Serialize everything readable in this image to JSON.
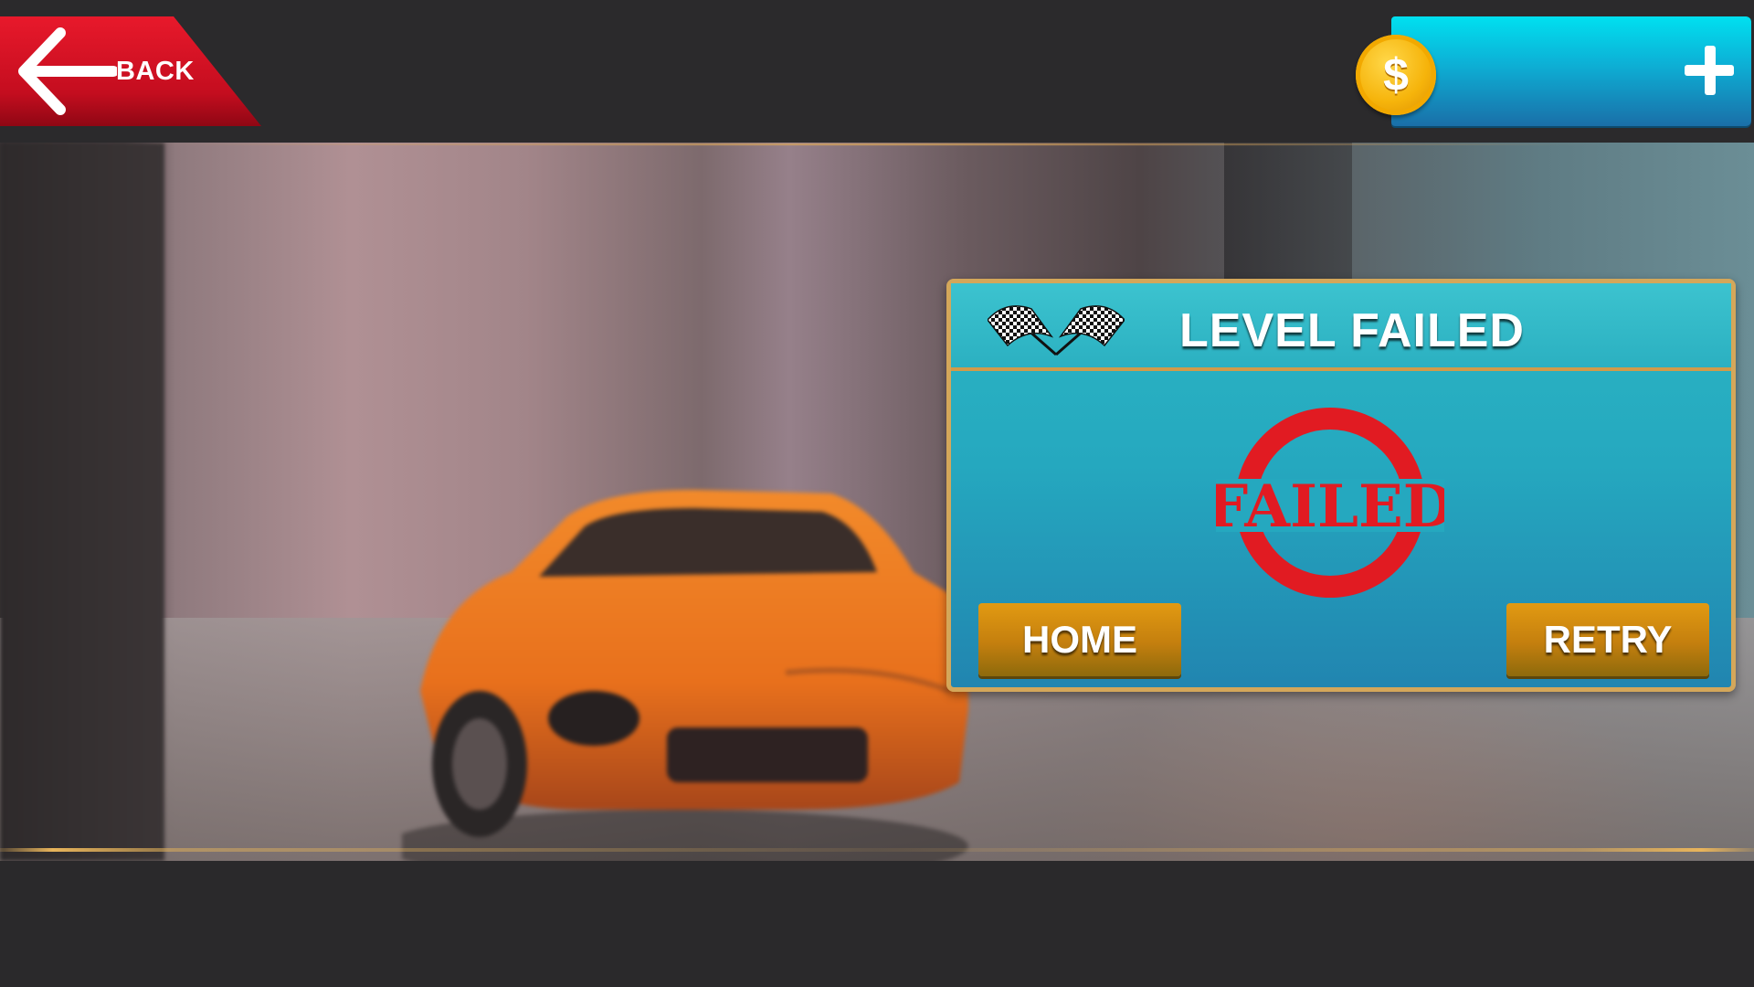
{
  "header": {
    "back_label": "BACK",
    "coins": {
      "value": "",
      "currency_icon": "dollar-coin-icon",
      "currency_symbol": "$"
    },
    "add_coins_icon": "plus-icon"
  },
  "dialog": {
    "title": "LEVEL FAILED",
    "stamp_text": "FAILED",
    "home_label": "HOME",
    "retry_label": "RETRY"
  },
  "colors": {
    "back_button": "#d9122a",
    "coin_bar": "#0cb4d8",
    "dialog_bg": "#25a8bf",
    "dialog_border": "#d4a75a",
    "button": "#c98a10",
    "stamp": "#e11b22"
  }
}
